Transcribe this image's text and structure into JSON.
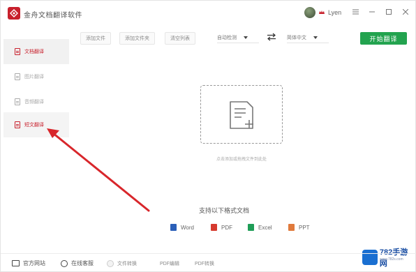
{
  "app": {
    "title": "金舟文档翻译软件",
    "brand_color": "#c8202c",
    "user": {
      "name": "Lyen"
    },
    "window_controls": [
      "menu",
      "minimize",
      "maximize",
      "close"
    ]
  },
  "sidebar": {
    "items": [
      {
        "label": "文档翻译",
        "icon": "document-icon",
        "state": "active"
      },
      {
        "label": "图片翻译",
        "icon": "image-icon",
        "state": "normal"
      },
      {
        "label": "音频翻译",
        "icon": "audio-icon",
        "state": "normal"
      },
      {
        "label": "短文翻译",
        "icon": "text-icon",
        "state": "hover"
      }
    ]
  },
  "toolbar": {
    "buttons": [
      "添加文件",
      "添加文件夹",
      "清空列表"
    ],
    "source_lang": "自动检测",
    "target_lang": "简体中文",
    "start_label": "开始翻译",
    "start_color": "#23a34f"
  },
  "main": {
    "drop_hint": "点击添加或拖拽文件到此处"
  },
  "formats": {
    "title": "支持以下格式文档",
    "items": [
      {
        "label": "Word",
        "color": "#2b5fb8"
      },
      {
        "label": "PDF",
        "color": "#d63a2f"
      },
      {
        "label": "Excel",
        "color": "#1f9d57"
      },
      {
        "label": "PPT",
        "color": "#e07a3c"
      }
    ]
  },
  "bottom": {
    "items": [
      {
        "label": "官方网站",
        "icon": "monitor-icon"
      },
      {
        "label": "在线客服",
        "icon": "headset-icon"
      },
      {
        "label": "文件转换",
        "icon": "convert-icon"
      },
      {
        "label": "PDF编辑",
        "icon": ""
      },
      {
        "label": "PDF转换",
        "icon": ""
      }
    ]
  },
  "watermark": {
    "text": "782手游网",
    "sub": "www.782s.com"
  }
}
